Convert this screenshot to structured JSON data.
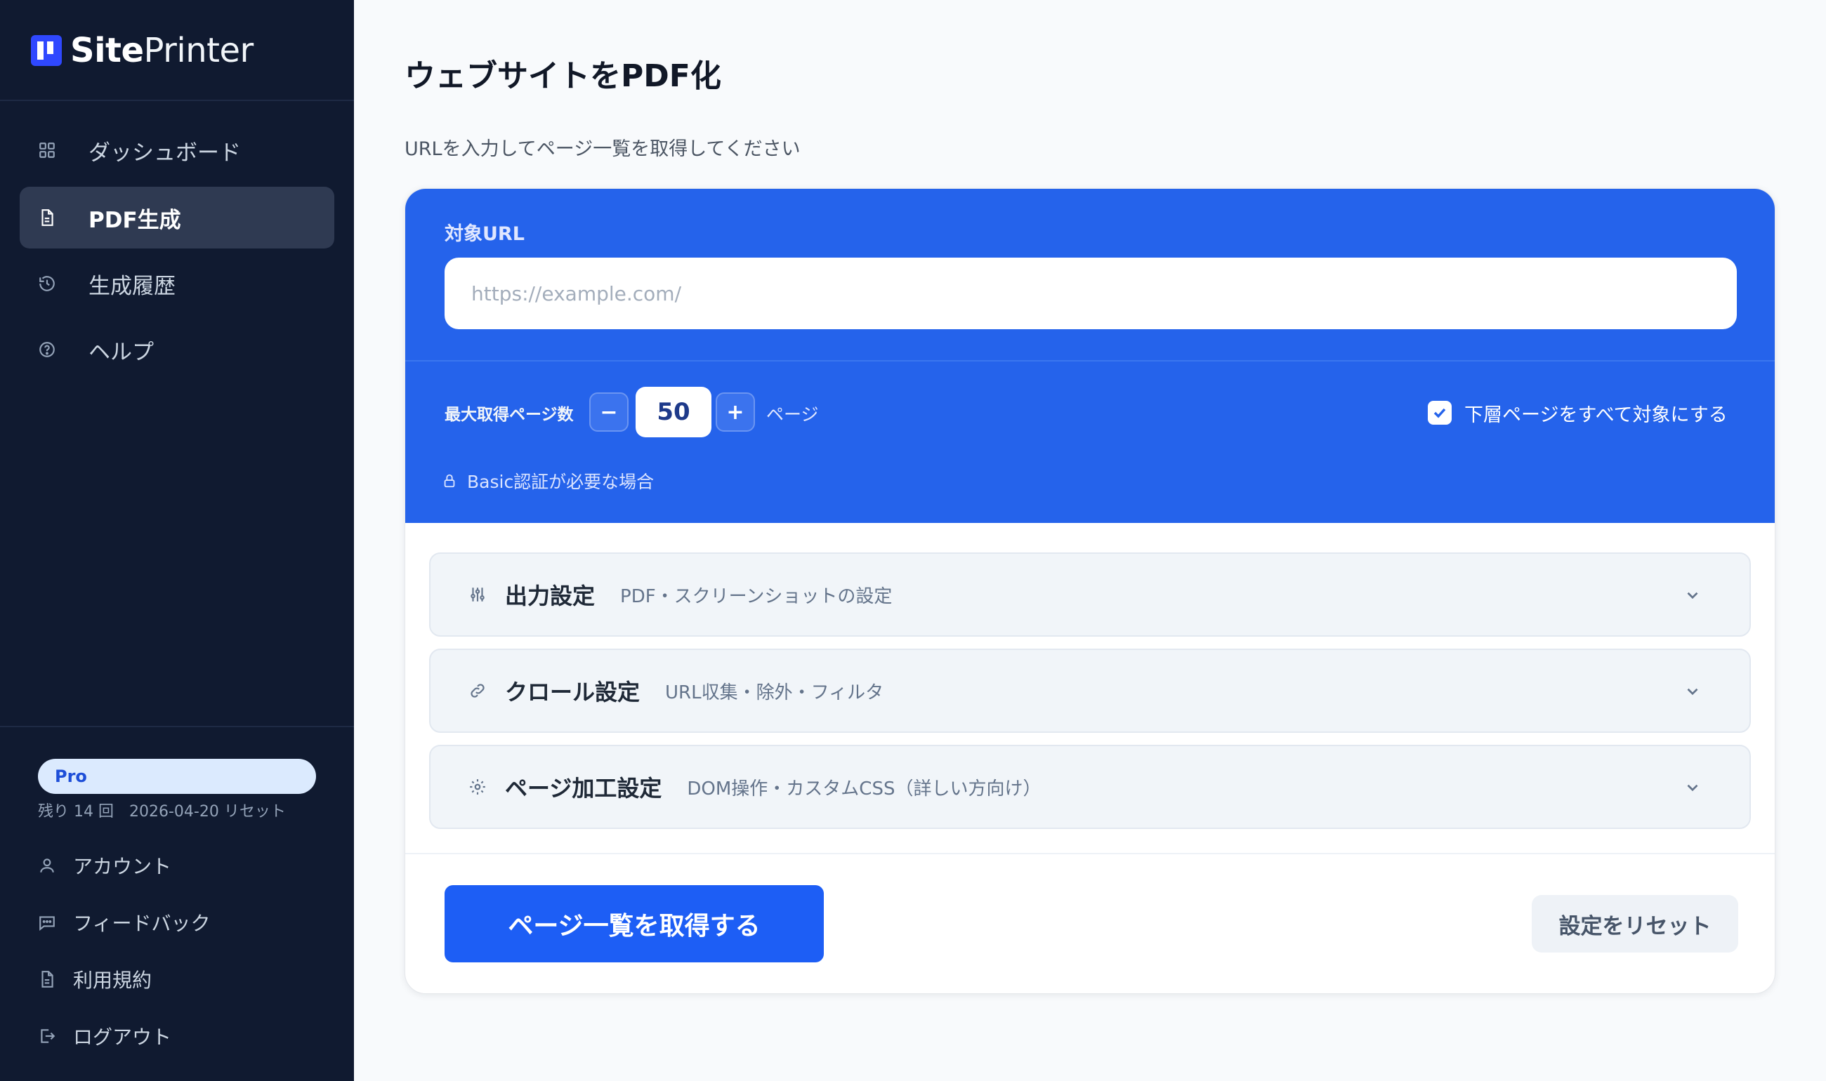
{
  "brand": {
    "name_bold": "Site",
    "name_light": "Printer"
  },
  "sidebar": {
    "nav": [
      {
        "label": "ダッシュボード",
        "icon": "grid-icon",
        "active": false
      },
      {
        "label": "PDF生成",
        "icon": "document-icon",
        "active": true
      },
      {
        "label": "生成履歴",
        "icon": "history-icon",
        "active": false
      },
      {
        "label": "ヘルプ",
        "icon": "help-icon",
        "active": false
      }
    ],
    "plan": {
      "badge": "Pro",
      "quota": "残り 14 回　2026-04-20 リセット"
    },
    "footer": [
      {
        "label": "アカウント",
        "icon": "user-icon"
      },
      {
        "label": "フィードバック",
        "icon": "chat-icon"
      },
      {
        "label": "利用規約",
        "icon": "document-icon"
      },
      {
        "label": "ログアウト",
        "icon": "logout-icon"
      }
    ]
  },
  "main": {
    "title": "ウェブサイトをPDF化",
    "subtitle": "URLを入力してページ一覧を取得してください",
    "url": {
      "label": "対象URL",
      "placeholder": "https://example.com/",
      "value": ""
    },
    "max_pages": {
      "label": "最大取得ページ数",
      "minus": "−",
      "value": "50",
      "plus": "+",
      "unit": "ページ"
    },
    "subpages": {
      "label": "下層ページをすべて対象にする",
      "checked": true
    },
    "basic_auth": "Basic認証が必要な場合",
    "sections": [
      {
        "title": "出力設定",
        "desc": "PDF・スクリーンショットの設定",
        "icon": "sliders-icon"
      },
      {
        "title": "クロール設定",
        "desc": "URL収集・除外・フィルタ",
        "icon": "link-icon"
      },
      {
        "title": "ページ加工設定",
        "desc": "DOM操作・カスタムCSS（詳しい方向け）",
        "icon": "gear-icon"
      }
    ],
    "primary_button": "ページ一覧を取得する",
    "reset_button": "設定をリセット"
  },
  "colors": {
    "sidebar_bg": "#101a30",
    "accent_blue": "#2563eb",
    "primary_button": "#1d5ef5",
    "pro_badge_bg": "#dbeafe",
    "page_bg": "#f8fafc"
  }
}
